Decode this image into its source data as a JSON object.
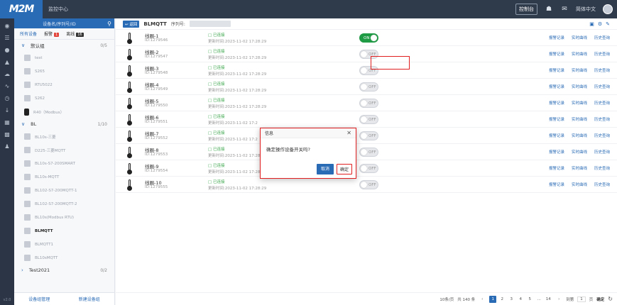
{
  "app": {
    "logo": "M2M",
    "title": "监控中心"
  },
  "topbar": {
    "console_btn": "控制台",
    "language": "简体中文"
  },
  "rail": {
    "version": "v2.0"
  },
  "sidebar": {
    "search_placeholder": "设备名/序列号/ID",
    "tabs": [
      {
        "label": "所有设备"
      },
      {
        "label": "报警",
        "count": "1"
      },
      {
        "label": "离线",
        "count": "16"
      }
    ],
    "group_default": {
      "label": "默认组",
      "count": "0/5"
    },
    "devices_default": [
      "test",
      "S265",
      "RTU5022",
      "S262",
      "R40（Modbus）"
    ],
    "group_bl": {
      "label": "BL",
      "count": "1/10"
    },
    "devices_bl": [
      "BL10s-三菱",
      "D225-三菱MQTT",
      "BL10s-S7-200SMART",
      "BL10s-MQTT",
      "BL102-S7-200MQTT-1",
      "BL102-S7-200MQTT-2",
      "BL10s(Modbus RTU)",
      "BLMQTT",
      "BLMQTT1",
      "BL10sMQTT"
    ],
    "group_test": {
      "label": "Test2021",
      "count": "0/2"
    },
    "footer": {
      "manage": "设备组管理",
      "new_group": "新建设备组"
    }
  },
  "main": {
    "back_label": "返回",
    "device_title": "BLMQTT",
    "sn_label": "序列号:",
    "channels": [
      {
        "name": "线圈-1",
        "id": "ID:1279546",
        "status": "已连接",
        "updated": "更新时间:2023-11-02 17:28:29",
        "state": "ON"
      },
      {
        "name": "线圈-2",
        "id": "ID:1279547",
        "status": "已连接",
        "updated": "更新时间:2023-11-02 17:28:29",
        "state": "OFF"
      },
      {
        "name": "线圈-3",
        "id": "ID:1279548",
        "status": "已连接",
        "updated": "更新时间:2023-11-02 17:28:29",
        "state": "OFF"
      },
      {
        "name": "线圈-4",
        "id": "ID:1279549",
        "status": "已连接",
        "updated": "更新时间:2023-11-02 17:28:29",
        "state": "OFF"
      },
      {
        "name": "线圈-5",
        "id": "ID:1279550",
        "status": "已连接",
        "updated": "更新时间:2023-11-02 17:28:29",
        "state": "OFF"
      },
      {
        "name": "线圈-6",
        "id": "ID:1279551",
        "status": "已连接",
        "updated": "更新时间:2023-11-02 17:2",
        "state": "OFF"
      },
      {
        "name": "线圈-7",
        "id": "ID:1279552",
        "status": "已连接",
        "updated": "更新时间:2023-11-02 17:2",
        "state": "OFF"
      },
      {
        "name": "线圈-8",
        "id": "ID:1279553",
        "status": "已连接",
        "updated": "更新时间:2023-11-02 17:28:29",
        "state": "OFF"
      },
      {
        "name": "线圈-9",
        "id": "ID:1279554",
        "status": "已连接",
        "updated": "更新时间:2023-11-02 17:28:29",
        "state": "OFF"
      },
      {
        "name": "线圈-10",
        "id": "ID:1279555",
        "status": "已连接",
        "updated": "更新时间:2023-11-02 17:28:29",
        "state": "OFF"
      }
    ],
    "links": {
      "alarm": "报警记录",
      "realtime": "实时曲线",
      "history": "历史查询"
    }
  },
  "pager": {
    "page_size": "10条/页",
    "total": "共 140 条",
    "pages": [
      "1",
      "2",
      "3",
      "4",
      "5",
      "...",
      "14"
    ],
    "goto": "到第",
    "goto_page": "1",
    "page_unit": "页",
    "confirm": "确定"
  },
  "dialog": {
    "title": "信息",
    "message": "确定操作设备开关吗?",
    "cancel": "取消",
    "ok": "确定"
  },
  "colors": {
    "primary": "#2a6bb5",
    "on": "#1f9a45",
    "alarm": "#e2453c",
    "offline": "#333333",
    "highlight": "#e02020"
  }
}
